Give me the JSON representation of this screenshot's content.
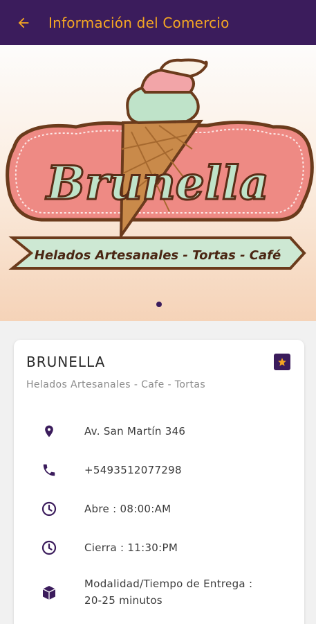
{
  "appbar": {
    "title": "Información del Comercio",
    "back_icon": "arrow-left-icon"
  },
  "banner": {
    "logo_text": "Brunella",
    "ribbon_text": "Helados Artesanales - Tortas - Café",
    "slides_total": 1,
    "active_slide": 1
  },
  "store": {
    "name": "BRUNELLA",
    "subtitle": "Helados Artesanales - Cafe - Tortas",
    "favorite_icon": "star-icon"
  },
  "info": {
    "address": "Av. San Martín 346",
    "phone": "+5493512077298",
    "opens": "Abre : 08:00:AM",
    "closes": "Cierra : 11:30:PM",
    "delivery_line1": "Modalidad/Tiempo de Entrega :",
    "delivery_line2": "20-25 minutos"
  },
  "colors": {
    "primary": "#3b1c5c",
    "accent": "#f5a623",
    "logo_pink": "#ef8a86",
    "logo_green": "#bfe3c9",
    "logo_brown": "#6b3b1c"
  }
}
